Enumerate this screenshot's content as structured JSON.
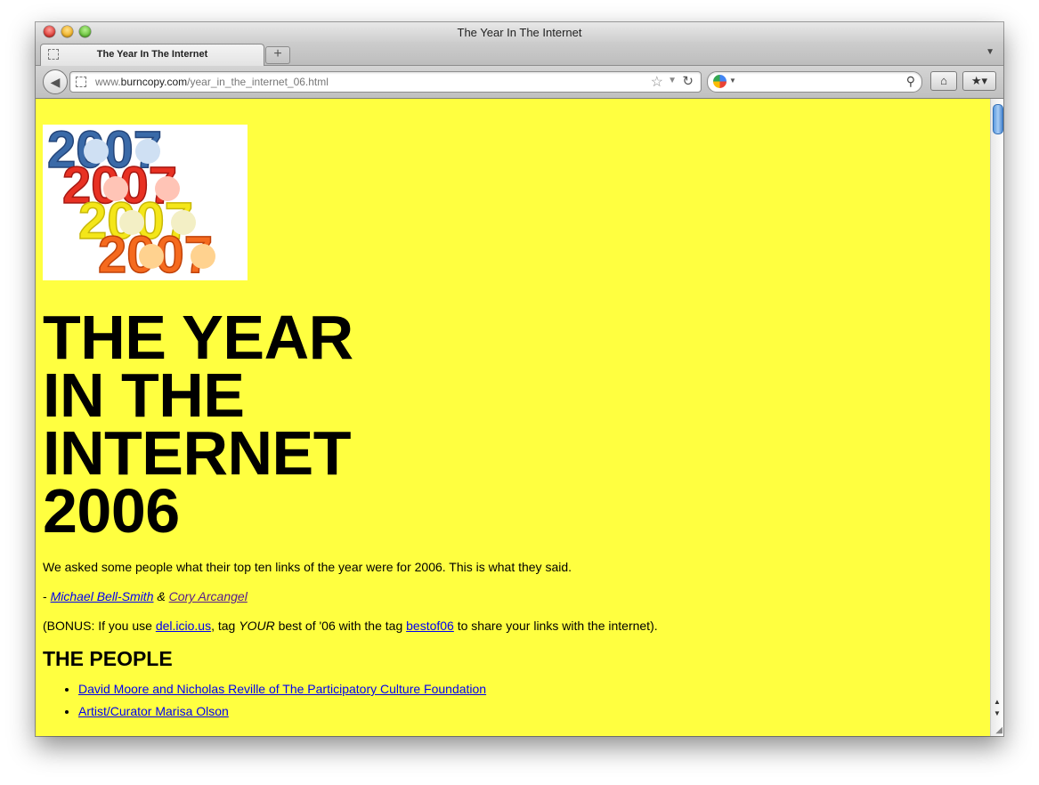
{
  "window": {
    "title": "The Year In The Internet"
  },
  "tab": {
    "label": "The Year In The Internet",
    "new_tab": "+"
  },
  "nav": {
    "url_domain_prefix": "www.",
    "url_domain": "burncopy.com",
    "url_path": "/year_in_the_internet_06.html"
  },
  "icons": {
    "back": "back-arrow-icon",
    "star": "bookmark-star-icon",
    "reload": "reload-icon",
    "search_engine": "google-icon",
    "magnifier": "search-icon",
    "home": "home-icon",
    "bookmarks": "bookmarks-icon"
  },
  "page": {
    "background": "#ffff40",
    "logo_text": "2007",
    "headline_lines": [
      "THE YEAR",
      "IN THE",
      "INTERNET",
      "2006"
    ],
    "intro": "We asked some people what their top ten links of the year were for 2006. This is what they said.",
    "byline_prefix": "- ",
    "author1": "Michael Bell-Smith",
    "byline_amp": " & ",
    "author2": "Cory Arcangel",
    "bonus_1": "(BONUS: If you use ",
    "bonus_link1": "del.icio.us",
    "bonus_2": ", tag ",
    "bonus_em": "YOUR",
    "bonus_3": " best of '06 with the tag ",
    "bonus_link2": "bestof06",
    "bonus_4": " to share your links with the internet).",
    "people_heading": "THE PEOPLE",
    "people": [
      "David Moore and Nicholas Reville of The Participatory Culture Foundation",
      "Artist/Curator Marisa Olson"
    ]
  }
}
